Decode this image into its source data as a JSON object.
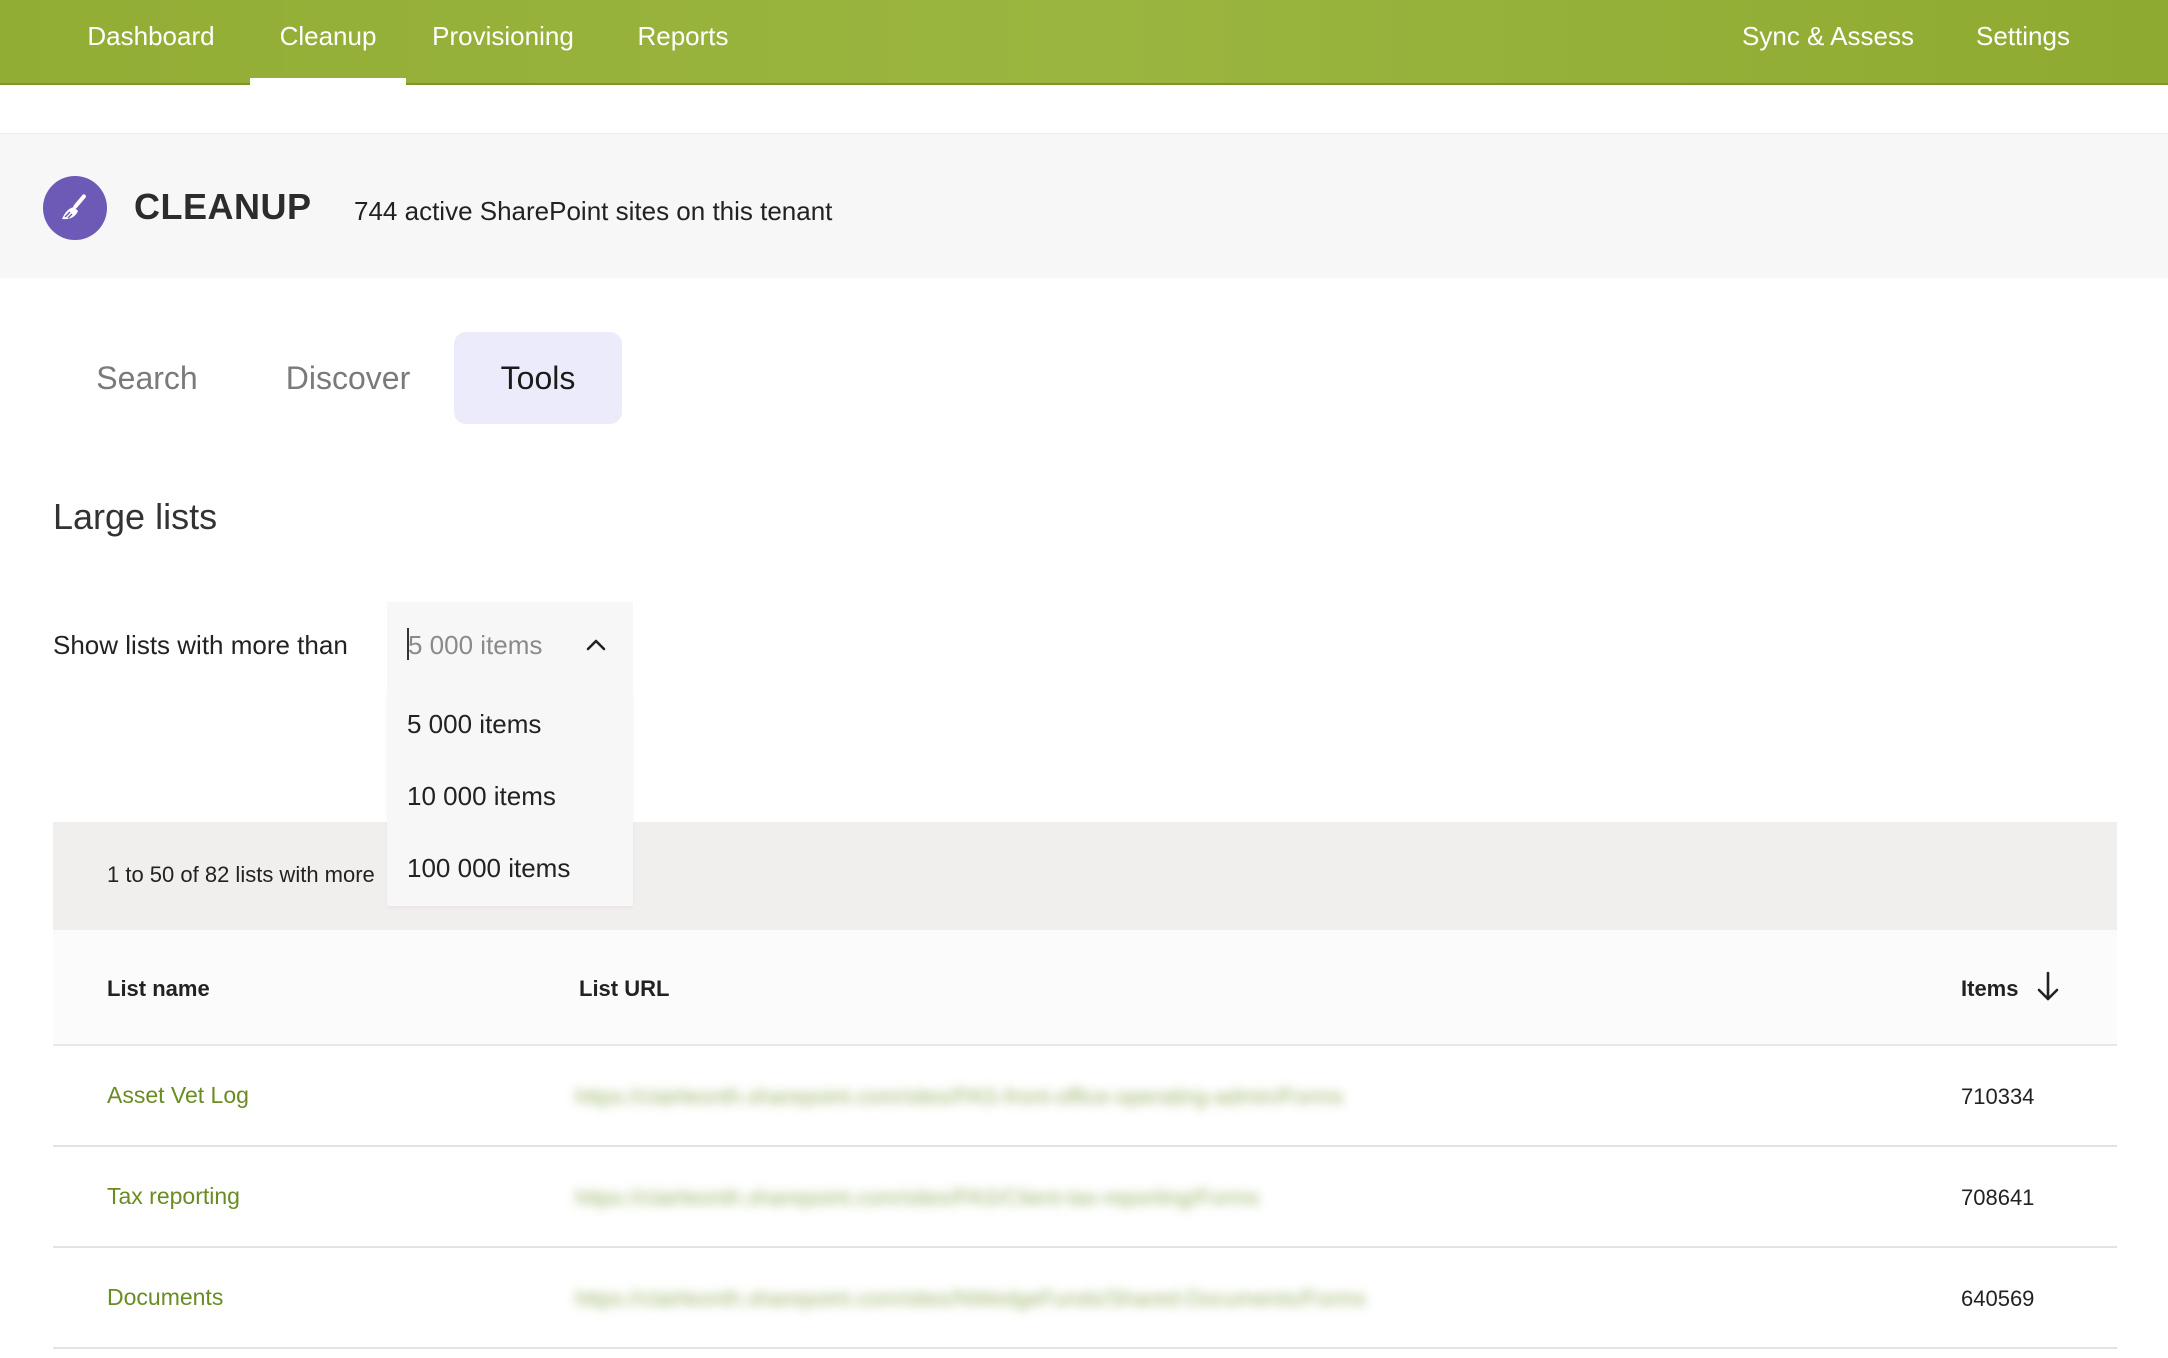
{
  "nav": {
    "items": [
      {
        "label": "Dashboard",
        "active": false
      },
      {
        "label": "Cleanup",
        "active": true
      },
      {
        "label": "Provisioning",
        "active": false
      },
      {
        "label": "Reports",
        "active": false
      }
    ],
    "right_items": [
      {
        "label": "Sync & Assess"
      },
      {
        "label": "Settings"
      }
    ]
  },
  "header": {
    "icon": "broom-icon",
    "title": "CLEANUP",
    "subtitle": "744 active SharePoint sites on this tenant"
  },
  "tabs": [
    {
      "label": "Search",
      "active": false
    },
    {
      "label": "Discover",
      "active": false
    },
    {
      "label": "Tools",
      "active": true
    }
  ],
  "section": {
    "title": "Large lists",
    "filter_label": "Show lists with more than",
    "select": {
      "placeholder": "5 000 items",
      "options": [
        "5 000 items",
        "10 000 items",
        "100 000 items"
      ]
    }
  },
  "results": {
    "summary": "1 to 50 of 82 lists with more"
  },
  "table": {
    "columns": [
      "List name",
      "List URL",
      "Items"
    ],
    "rows": [
      {
        "name": "Asset Vet Log",
        "url": "https://clairleonth.sharepoint.com/sites/PAS-front-office-operating-admin/Forms",
        "items": "710334"
      },
      {
        "name": "Tax reporting",
        "url": "https://clairleonth.sharepoint.com/sites/PAS/Client-tax-reporting/Forms",
        "items": "708641"
      },
      {
        "name": "Documents",
        "url": "https://clairleonth.sharepoint.com/sites/NWedgeFunds/Shared-Documents/Forms",
        "items": "640569"
      }
    ]
  },
  "colors": {
    "nav_green": "#9bb640",
    "accent_purple": "#6d59b6",
    "link_green": "#6a8c22",
    "active_tab_bg": "#ecebfb"
  }
}
